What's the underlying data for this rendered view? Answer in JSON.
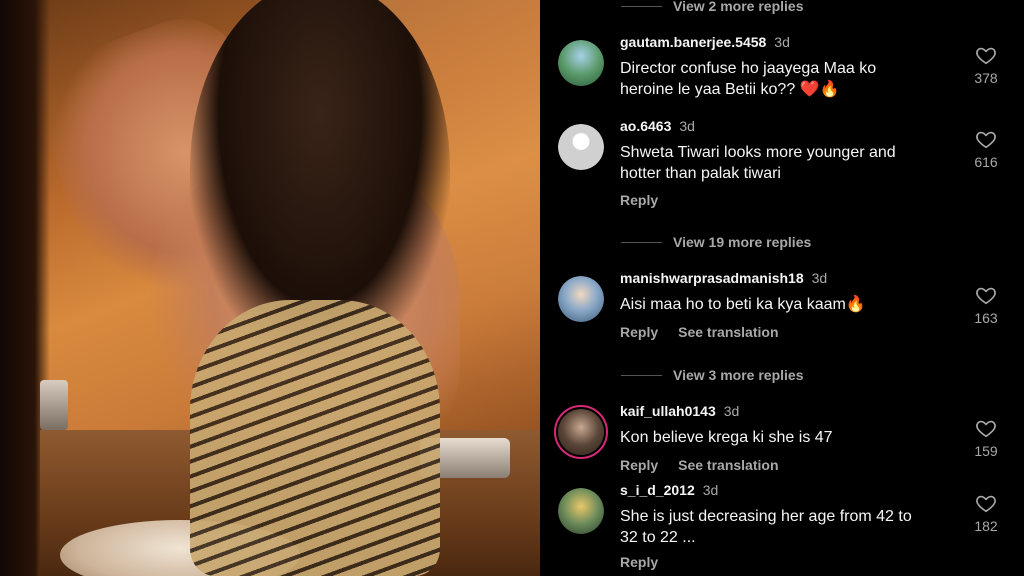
{
  "comments": [
    {
      "username": "gautam.banerjee.5458",
      "time": "3d",
      "text_line1": "Director confuse ho jaayega Maa ko",
      "text_line2": "heroine le yaa Betii ko?? ❤️🔥",
      "likes": "378",
      "avatar_color": "#3a7a4a"
    },
    {
      "username": "ao.6463",
      "time": "3d",
      "text_line1": "Shweta Tiwari looks more younger and",
      "text_line2": "hotter than palak tiwari",
      "reply": "Reply",
      "likes": "616",
      "avatar_color": "#cfcfcf"
    },
    {
      "username": "manishwarprasadmanish18",
      "time": "3d",
      "text_line1": "Aisi maa ho to beti ka kya kaam🔥",
      "reply": "Reply",
      "translate": "See translation",
      "likes": "163",
      "avatar_color": "#6a8aa8"
    },
    {
      "username": "kaif_ullah0143",
      "time": "3d",
      "text_line1": "Kon believe krega ki she is 47",
      "reply": "Reply",
      "translate": "See translation",
      "likes": "159",
      "avatar_color": "#4a3a30"
    },
    {
      "username": "s_i_d_2012",
      "time": "3d",
      "text_line1": "She is just decreasing her age from 42 to",
      "text_line2": "32 to 22 ...",
      "reply": "Reply",
      "likes": "182",
      "avatar_color": "#5a7a5a"
    }
  ],
  "view_replies": [
    "View 2 more replies",
    "View 19 more replies",
    "View 3 more replies"
  ],
  "icons": {
    "heart": "heart-outline-icon"
  },
  "colors": {
    "text_primary": "#f5f5f5",
    "text_secondary": "#a8a8a8",
    "background": "#000000",
    "story_ring": "#d62976"
  }
}
